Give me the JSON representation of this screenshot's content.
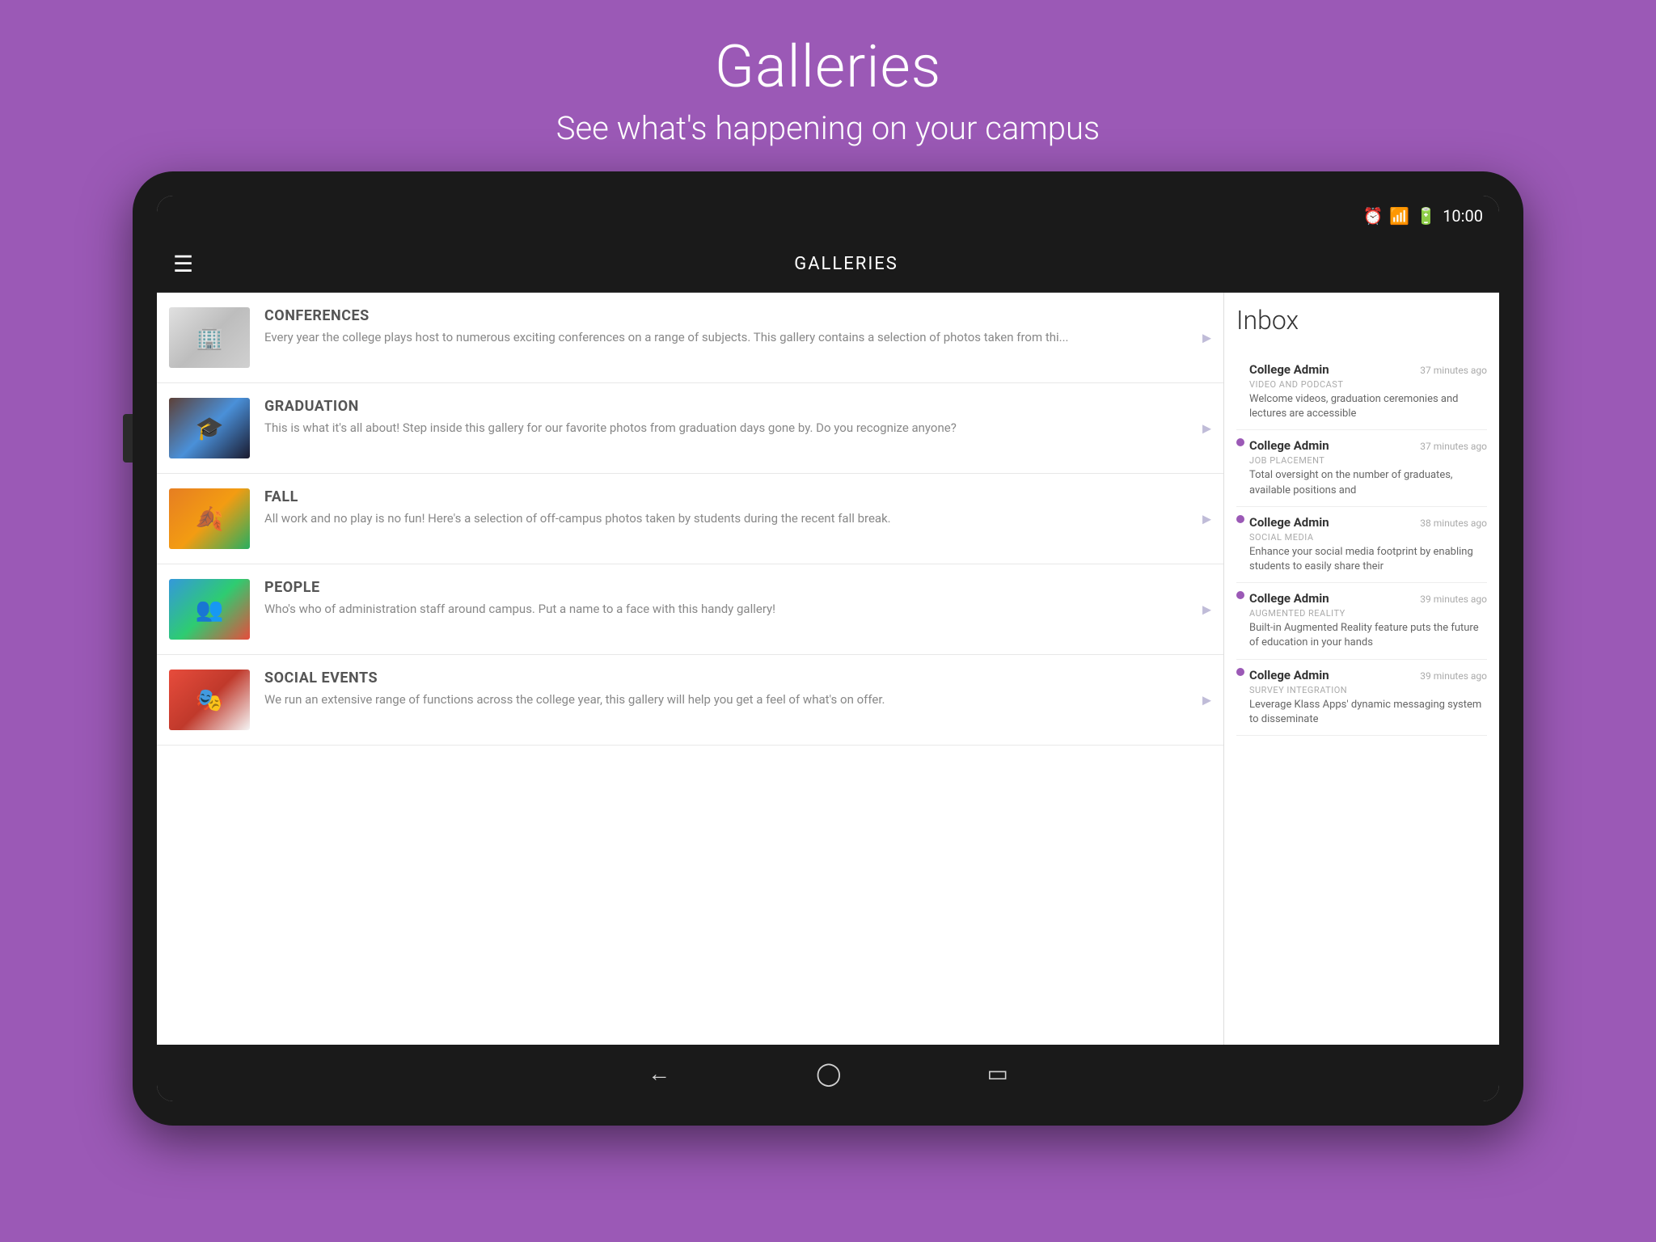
{
  "page": {
    "bg_color": "#9b59b6",
    "title": "Galleries",
    "subtitle": "See what's happening on your campus"
  },
  "status_bar": {
    "time": "10:00"
  },
  "app_bar": {
    "title": "GALLERIES",
    "menu_icon": "☰"
  },
  "gallery_items": [
    {
      "id": "conferences",
      "title": "CONFERENCES",
      "description": "Every year the college plays host to numerous exciting conferences on a range of subjects.  This gallery contains a selection of photos taken from thi...",
      "thumb_class": "thumb-conferences",
      "thumb_icon": "🏢"
    },
    {
      "id": "graduation",
      "title": "GRADUATION",
      "description": "This is what it's all about!  Step inside this gallery for our favorite photos from graduation days gone by.  Do you recognize anyone?",
      "thumb_class": "thumb-graduation",
      "thumb_icon": "🎓"
    },
    {
      "id": "fall",
      "title": "FALL",
      "description": "All work and no play is no fun!  Here's a selection of off-campus photos taken by students during the recent fall break.",
      "thumb_class": "thumb-fall",
      "thumb_icon": "🍂"
    },
    {
      "id": "people",
      "title": "PEOPLE",
      "description": "Who's who of administration staff around campus.  Put a name to a face with this handy gallery!",
      "thumb_class": "thumb-people",
      "thumb_icon": "👥"
    },
    {
      "id": "social-events",
      "title": "SOCIAL EVENTS",
      "description": "We run an extensive range of functions across the college year, this gallery will help you get a feel of what's on offer.",
      "thumb_class": "thumb-social",
      "thumb_icon": "🎭"
    }
  ],
  "inbox": {
    "title": "Inbox",
    "items": [
      {
        "sender": "College Admin",
        "time": "37 minutes ago",
        "category": "VIDEO AND PODCAST",
        "preview": "Welcome videos, graduation ceremonies and lectures are accessible",
        "has_dot": false
      },
      {
        "sender": "College Admin",
        "time": "37 minutes ago",
        "category": "JOB PLACEMENT",
        "preview": "Total oversight on the number of graduates, available positions and",
        "has_dot": true
      },
      {
        "sender": "College Admin",
        "time": "38 minutes ago",
        "category": "SOCIAL MEDIA",
        "preview": "Enhance your social media footprint by enabling students to easily share their",
        "has_dot": true
      },
      {
        "sender": "College Admin",
        "time": "39 minutes ago",
        "category": "AUGMENTED REALITY",
        "preview": "Built-in Augmented Reality feature puts the future of education in your hands",
        "has_dot": true
      },
      {
        "sender": "College Admin",
        "time": "39 minutes ago",
        "category": "SURVEY INTEGRATION",
        "preview": "Leverage Klass Apps' dynamic messaging system to disseminate",
        "has_dot": true
      }
    ]
  },
  "nav_bar": {
    "back_icon": "←",
    "home_icon": "⌂",
    "recents_icon": "▭"
  }
}
